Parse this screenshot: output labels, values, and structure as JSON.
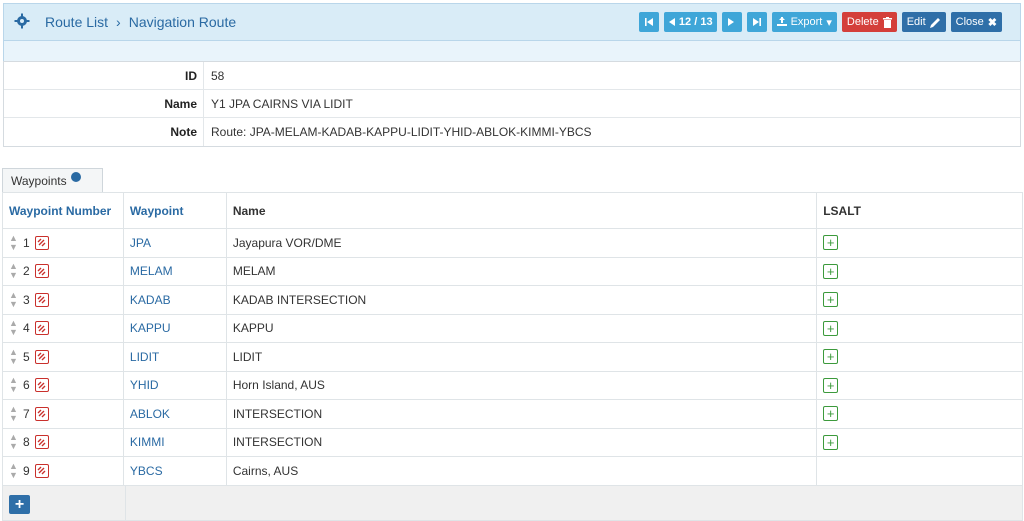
{
  "breadcrumb": {
    "root": "Route List",
    "sep": "›",
    "current": "Navigation Route"
  },
  "toolbar": {
    "pager": "12 / 13",
    "export": "Export",
    "delete": "Delete",
    "edit": "Edit",
    "close": "Close"
  },
  "details": {
    "id_label": "ID",
    "id_value": "58",
    "name_label": "Name",
    "name_value": "Y1 JPA CAIRNS VIA LIDIT",
    "note_label": "Note",
    "note_value": "Route: JPA-MELAM-KADAB-KAPPU-LIDIT-YHID-ABLOK-KIMMI-YBCS"
  },
  "tab": {
    "label": "Waypoints"
  },
  "table": {
    "headers": [
      "Waypoint Number",
      "Waypoint",
      "Name",
      "LSALT"
    ],
    "rows": [
      {
        "num": "1",
        "wp": "JPA",
        "name": "Jayapura VOR/DME",
        "lsalt": true
      },
      {
        "num": "2",
        "wp": "MELAM",
        "name": "MELAM",
        "lsalt": true
      },
      {
        "num": "3",
        "wp": "KADAB",
        "name": "KADAB INTERSECTION",
        "lsalt": true
      },
      {
        "num": "4",
        "wp": "KAPPU",
        "name": "KAPPU",
        "lsalt": true
      },
      {
        "num": "5",
        "wp": "LIDIT",
        "name": "LIDIT",
        "lsalt": true
      },
      {
        "num": "6",
        "wp": "YHID",
        "name": "Horn Island, AUS",
        "lsalt": true
      },
      {
        "num": "7",
        "wp": "ABLOK",
        "name": "INTERSECTION",
        "lsalt": true
      },
      {
        "num": "8",
        "wp": "KIMMI",
        "name": "INTERSECTION",
        "lsalt": true
      },
      {
        "num": "9",
        "wp": "YBCS",
        "name": "Cairns, AUS",
        "lsalt": false
      }
    ]
  },
  "colors": {
    "accent": "#2a6aa3",
    "danger": "#d43f3a",
    "success": "#3c9a3c",
    "header_bg": "#d9ecf7"
  },
  "icons": {
    "gear": "gear-icon",
    "first": "first-page-icon",
    "prev": "prev-page-icon",
    "next": "next-page-icon",
    "last": "last-page-icon",
    "export": "export-icon",
    "trash": "trash-icon",
    "pencil": "pencil-icon",
    "close": "close-icon",
    "sort": "sort-handle-icon",
    "remove": "unlink-icon",
    "add": "add-icon"
  }
}
